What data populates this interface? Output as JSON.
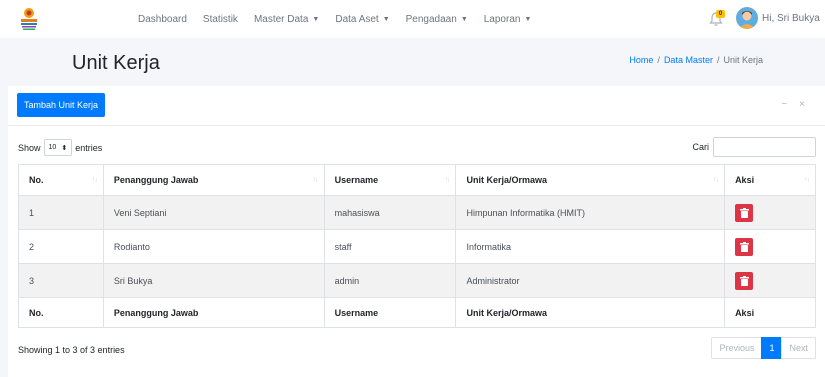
{
  "navbar": {
    "logo_icon": "institution-logo-icon",
    "items": [
      {
        "label": "Dashboard",
        "dropdown": false
      },
      {
        "label": "Statistik",
        "dropdown": false
      },
      {
        "label": "Master Data",
        "dropdown": true
      },
      {
        "label": "Data Aset",
        "dropdown": true
      },
      {
        "label": "Pengadaan",
        "dropdown": true
      },
      {
        "label": "Laporan",
        "dropdown": true
      }
    ],
    "notification_count": "0",
    "user_greeting": "Hi, Sri Bukya"
  },
  "header": {
    "title": "Unit Kerja",
    "breadcrumb": [
      "Home",
      "Data Master",
      "Unit Kerja"
    ]
  },
  "card": {
    "add_button": "Tambah Unit Kerja",
    "tools": {
      "collapse": "−",
      "remove": "×"
    }
  },
  "datatable": {
    "length_prefix": "Show",
    "length_value": "10",
    "length_suffix": "entries",
    "search_label": "Cari",
    "search_value": "",
    "columns": [
      "No.",
      "Penanggung Jawab",
      "Username",
      "Unit Kerja/Ormawa",
      "Aksi"
    ],
    "rows": [
      {
        "no": "1",
        "penanggung_jawab": "Veni Septiani",
        "username": "mahasiswa",
        "unit_kerja": "Himpunan Informatika (HMIT)"
      },
      {
        "no": "2",
        "penanggung_jawab": "Rodianto",
        "username": "staff",
        "unit_kerja": "Informatika"
      },
      {
        "no": "3",
        "penanggung_jawab": "Sri Bukya",
        "username": "admin",
        "unit_kerja": "Administrator"
      }
    ],
    "info": "Showing 1 to 3 of 3 entries",
    "pagination": {
      "previous": "Previous",
      "current": "1",
      "next": "Next"
    }
  },
  "colors": {
    "primary": "#007bff",
    "danger": "#dc3545",
    "badge": "#ffc107",
    "avatar": "#f0ad4e"
  }
}
